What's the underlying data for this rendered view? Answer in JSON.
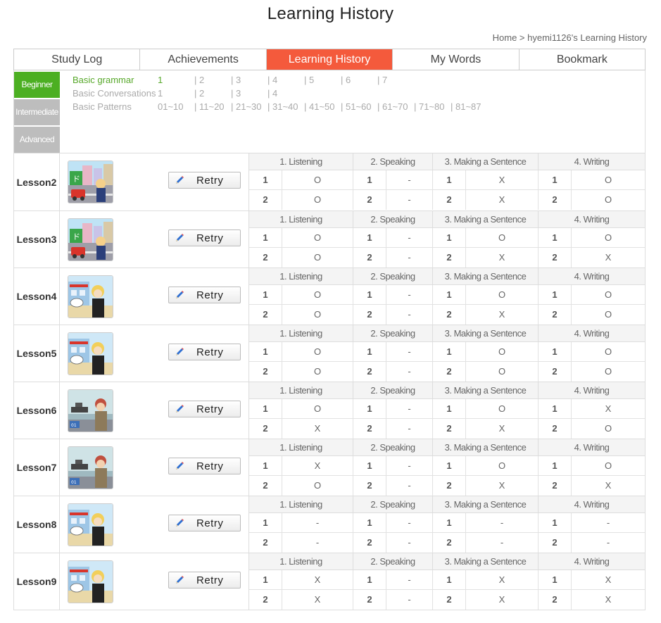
{
  "page": {
    "title": "Learning History",
    "breadcrumb": "Home > hyemi1126's Learning History"
  },
  "tabs": [
    "Study Log",
    "Achievements",
    "Learning History",
    "My Words",
    "Bookmark"
  ],
  "active_tab": "Learning History",
  "levels": [
    "Beginner",
    "Intermediate",
    "Advanced"
  ],
  "active_level": "Beginner",
  "courses": [
    {
      "name": "Basic grammar",
      "units": [
        "1",
        "| 2",
        "| 3",
        "| 4",
        "| 5",
        "| 6",
        "| 7"
      ],
      "active": true
    },
    {
      "name": "Basic Conversations",
      "units": [
        "1",
        "| 2",
        "| 3",
        "| 4"
      ],
      "active": false
    },
    {
      "name": "Basic Patterns",
      "units": [
        "01~10",
        "| 11~20",
        "| 21~30",
        "| 31~40",
        "| 41~50",
        "| 51~60",
        "| 61~70",
        "| 71~80",
        "| 81~87"
      ],
      "active": false
    }
  ],
  "sections": [
    "1. Listening",
    "2. Speaking",
    "3. Making a Sentence",
    "4. Writing"
  ],
  "retry_label": "Retry",
  "lessons": [
    {
      "name": "Lesson2",
      "thumb": "city-street",
      "results": [
        [
          "O",
          "-",
          "X",
          "O"
        ],
        [
          "O",
          "-",
          "X",
          "O"
        ]
      ]
    },
    {
      "name": "Lesson3",
      "thumb": "city-street",
      "results": [
        [
          "O",
          "-",
          "O",
          "O"
        ],
        [
          "O",
          "-",
          "X",
          "X"
        ]
      ]
    },
    {
      "name": "Lesson4",
      "thumb": "building-girl",
      "results": [
        [
          "O",
          "-",
          "O",
          "O"
        ],
        [
          "O",
          "-",
          "X",
          "O"
        ]
      ]
    },
    {
      "name": "Lesson5",
      "thumb": "building-girl",
      "results": [
        [
          "O",
          "-",
          "O",
          "O"
        ],
        [
          "O",
          "-",
          "O",
          "O"
        ]
      ]
    },
    {
      "name": "Lesson6",
      "thumb": "harbor",
      "results": [
        [
          "O",
          "-",
          "O",
          "X"
        ],
        [
          "X",
          "-",
          "X",
          "O"
        ]
      ]
    },
    {
      "name": "Lesson7",
      "thumb": "harbor",
      "results": [
        [
          "X",
          "-",
          "O",
          "O"
        ],
        [
          "O",
          "-",
          "X",
          "X"
        ]
      ]
    },
    {
      "name": "Lesson8",
      "thumb": "building-girl",
      "results": [
        [
          "-",
          "-",
          "-",
          "-"
        ],
        [
          "-",
          "-",
          "-",
          "-"
        ]
      ]
    },
    {
      "name": "Lesson9",
      "thumb": "building-girl",
      "results": [
        [
          "X",
          "-",
          "X",
          "X"
        ],
        [
          "X",
          "-",
          "X",
          "X"
        ]
      ]
    }
  ],
  "colors": {
    "tab_active": "#f45a3c",
    "level_active": "#4caf22",
    "level_inactive": "#bdbdbd",
    "course_active": "#57a82a"
  }
}
